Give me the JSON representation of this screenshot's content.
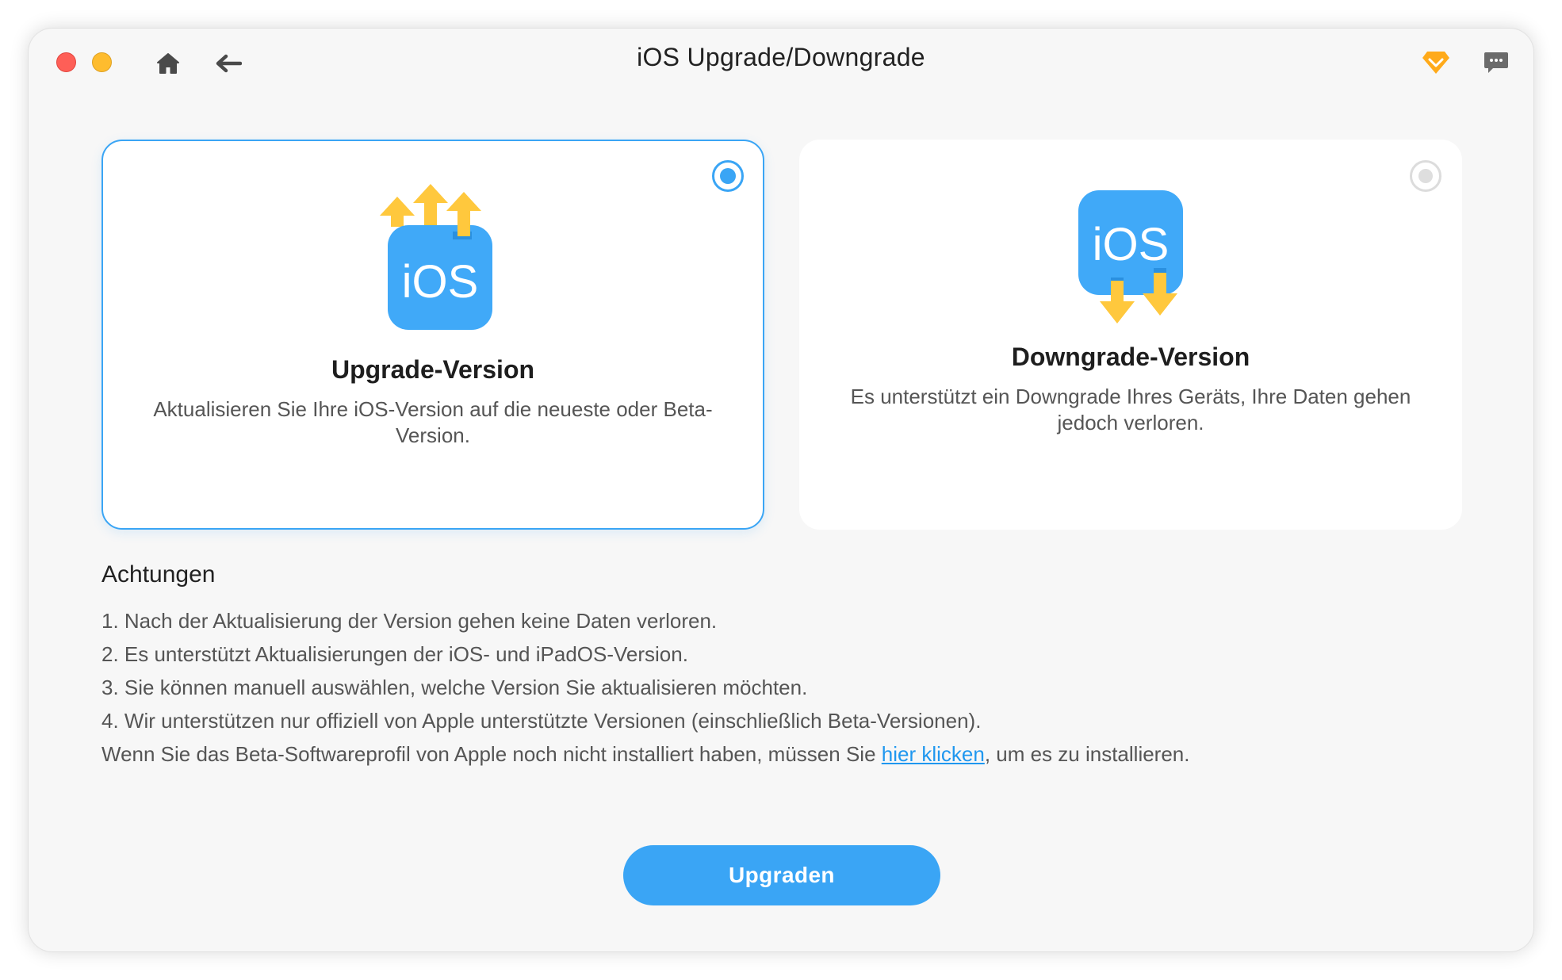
{
  "window": {
    "title": "iOS Upgrade/Downgrade"
  },
  "colors": {
    "accent": "#3aa5f5",
    "link": "#1f97ef",
    "arrow_yellow": "#ffc83d",
    "close": "#fe5f57",
    "minimize": "#febc2e",
    "premium": "#ffaa1a"
  },
  "icons": {
    "home": "home-icon",
    "back": "back-arrow-icon",
    "premium": "diamond-icon",
    "chat": "chat-bubble-icon"
  },
  "options": {
    "upgrade": {
      "selected": true,
      "icon_text": "iOS",
      "title": "Upgrade-Version",
      "description": "Aktualisieren Sie Ihre iOS-Version auf die neueste oder Beta-Version."
    },
    "downgrade": {
      "selected": false,
      "icon_text": "iOS",
      "title": "Downgrade-Version",
      "description": "Es unterstützt ein Downgrade Ihres Geräts, Ihre Daten gehen jedoch verloren."
    }
  },
  "notes": {
    "title": "Achtungen",
    "items": [
      "1. Nach der Aktualisierung der Version gehen keine Daten verloren.",
      "2. Es unterstützt Aktualisierungen der iOS- und iPadOS-Version.",
      "3. Sie können manuell auswählen, welche Version Sie aktualisieren möchten.",
      "4. Wir unterstützen nur offiziell von Apple unterstützte Versionen (einschließlich Beta-Versionen)."
    ],
    "profile_prefix": "Wenn Sie das Beta-Softwareprofil von Apple noch nicht installiert haben, müssen Sie ",
    "profile_link": "hier klicken",
    "profile_suffix": ", um es zu installieren."
  },
  "action": {
    "button_label": "Upgraden"
  }
}
